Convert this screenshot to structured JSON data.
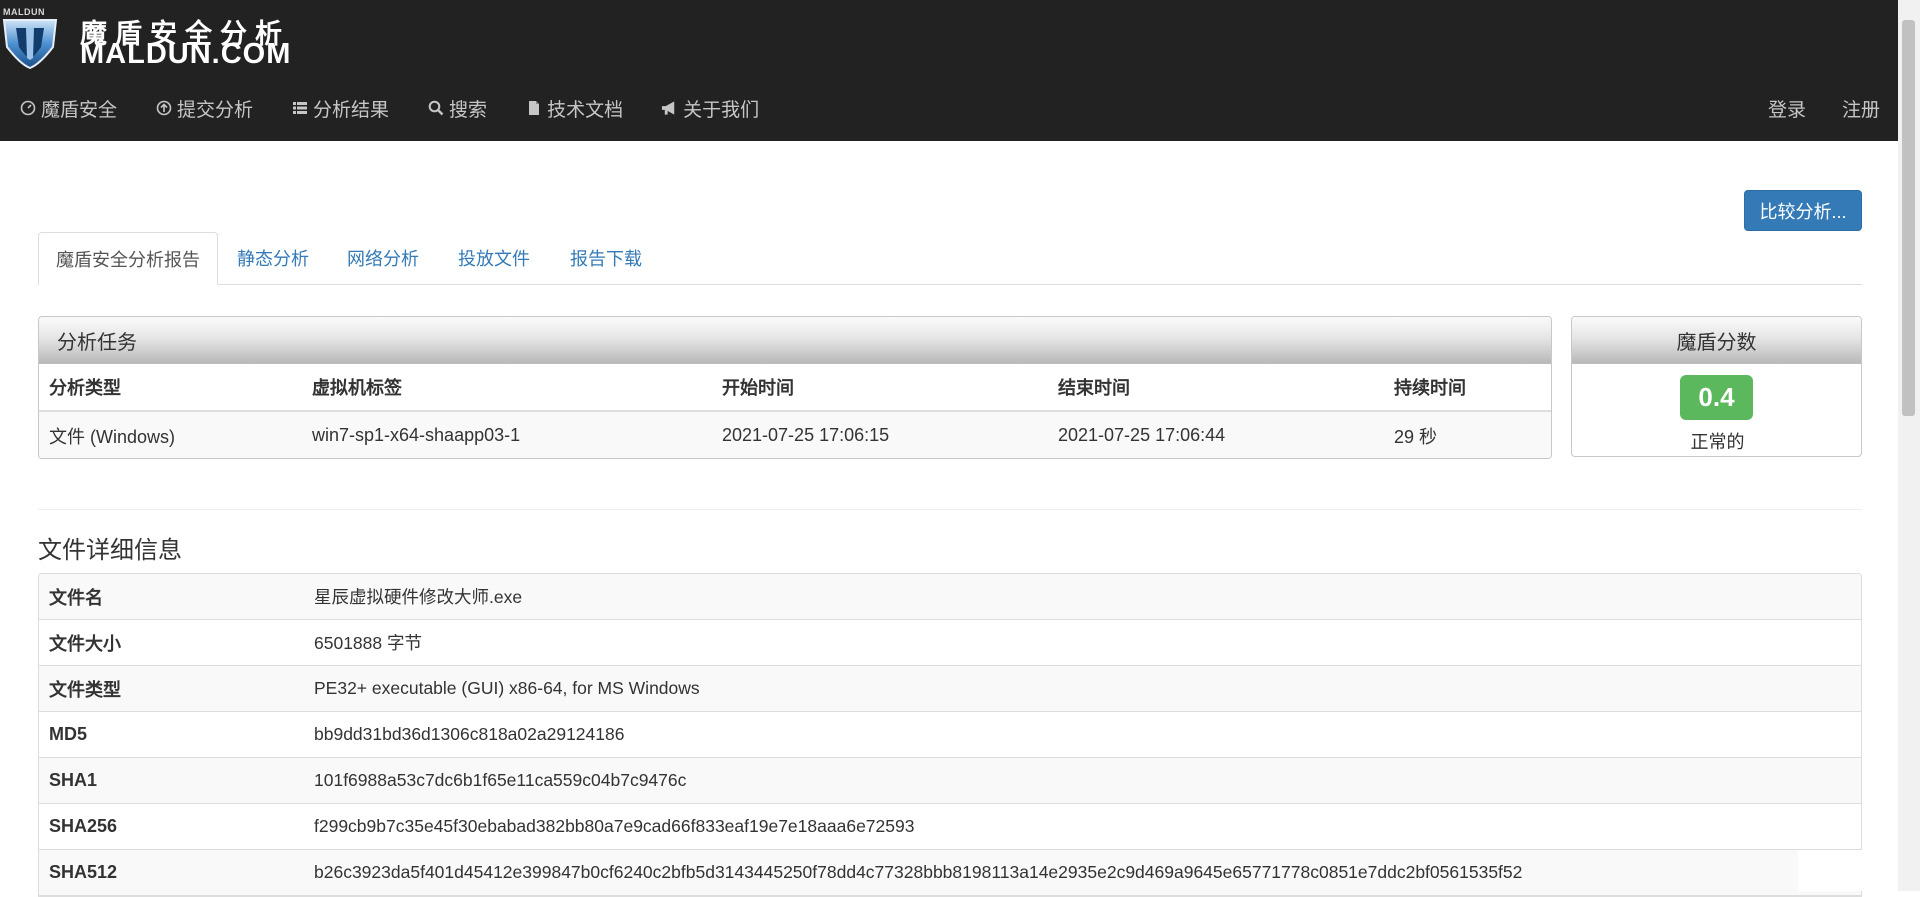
{
  "brand": {
    "small_text": "MALDUN",
    "name_cn": "魔盾安全分析",
    "name_en": "MALDUN.COM"
  },
  "nav": {
    "items": [
      {
        "label": "魔盾安全",
        "icon": "dashboard-icon"
      },
      {
        "label": "提交分析",
        "icon": "upload-icon"
      },
      {
        "label": "分析结果",
        "icon": "list-icon"
      },
      {
        "label": "搜索",
        "icon": "search-icon"
      },
      {
        "label": "技术文档",
        "icon": "file-icon"
      },
      {
        "label": "关于我们",
        "icon": "bullhorn-icon"
      }
    ],
    "login": "登录",
    "register": "注册"
  },
  "compare_button": "比较分析...",
  "tabs": [
    "魔盾安全分析报告",
    "静态分析",
    "网络分析",
    "投放文件",
    "报告下载"
  ],
  "task": {
    "title": "分析任务",
    "columns": [
      "分析类型",
      "虚拟机标签",
      "开始时间",
      "结束时间",
      "持续时间"
    ],
    "row": [
      "文件 (Windows)",
      "win7-sp1-x64-shaapp03-1",
      "2021-07-25 17:06:15",
      "2021-07-25 17:06:44",
      "29 秒"
    ]
  },
  "score": {
    "title": "魔盾分数",
    "value": "0.4",
    "label": "正常的",
    "color": "#5cb85c"
  },
  "file_details": {
    "title": "文件详细信息",
    "rows": [
      {
        "key": "文件名",
        "value": "星辰虚拟硬件修改大师.exe"
      },
      {
        "key": "文件大小",
        "value": "6501888 字节"
      },
      {
        "key": "文件类型",
        "value": "PE32+ executable (GUI) x86-64, for MS Windows"
      },
      {
        "key": "MD5",
        "value": "bb9dd31bd36d1306c818a02a29124186"
      },
      {
        "key": "SHA1",
        "value": "101f6988a53c7dc6b1f65e11ca559c04b7c9476c"
      },
      {
        "key": "SHA256",
        "value": "f299cb9b7c35e45f30ebabad382bb80a7e9cad66f833eaf19e7e18aaa6e72593"
      },
      {
        "key": "SHA512",
        "value": "b26c3923da5f401d45412e399847b0cf6240c2bfb5d3143445250f78dd4c77328bbb8198113a14e2935e2c9d469a9645e65771778c0851e7ddc2bf0561535f52"
      }
    ]
  },
  "colors": {
    "header_bg": "#222222",
    "primary": "#337ab7",
    "success": "#5cb85c"
  }
}
